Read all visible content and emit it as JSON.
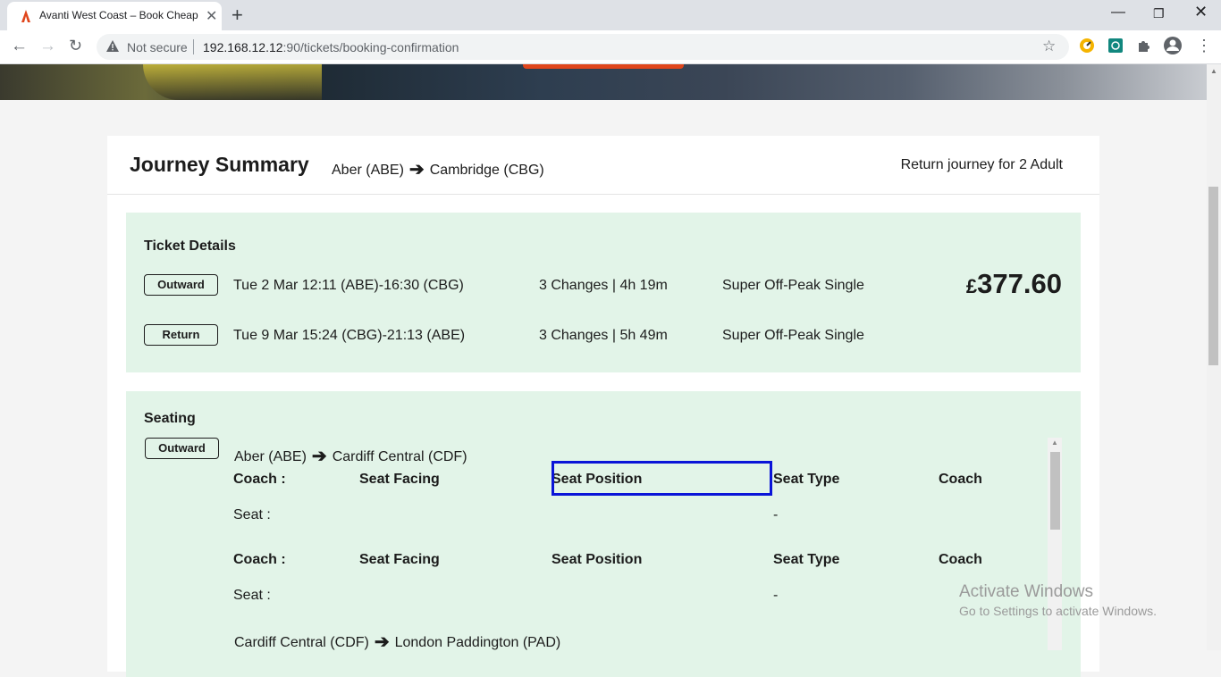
{
  "browser": {
    "tab_title": "Avanti West Coast – Book Cheap",
    "security_label": "Not secure",
    "url_host": "192.168.12.12",
    "url_path": ":90/tickets/booking-confirmation",
    "icons": [
      "avanti-favicon",
      "close-icon",
      "new-tab-icon",
      "minimize-icon",
      "restore-icon",
      "close-window-icon",
      "back-icon",
      "forward-icon",
      "reload-icon",
      "warning-icon",
      "star-icon",
      "extension-icons",
      "profile-icon",
      "menu-icon"
    ]
  },
  "summary": {
    "title": "Journey Summary",
    "from": "Aber (ABE)",
    "to": "Cambridge (CBG)",
    "journey_type": "Return journey for 2 Adult"
  },
  "tickets": {
    "heading": "Ticket Details",
    "price_currency": "£",
    "price_amount": "377.60",
    "rows": [
      {
        "badge": "Outward",
        "times": "Tue 2 Mar 12:11 (ABE)-16:30 (CBG)",
        "changes": "3 Changes | 4h 19m",
        "fare": "Super Off-Peak Single"
      },
      {
        "badge": "Return",
        "times": "Tue 9 Mar 15:24 (CBG)-21:13 (ABE)",
        "changes": "3 Changes | 5h 49m",
        "fare": "Super Off-Peak Single"
      }
    ]
  },
  "seating": {
    "heading": "Seating",
    "badge": "Outward",
    "leg1_from": "Aber (ABE)",
    "leg1_to": "Cardiff Central (CDF)",
    "headers": {
      "coach": "Coach :",
      "facing": "Seat Facing",
      "position": "Seat Position",
      "type": "Seat Type",
      "coach2": "Coach"
    },
    "seat_label": "Seat :",
    "seat_type_value": "-",
    "leg2_from": "Cardiff Central (CDF)",
    "leg2_to": "London Paddington (PAD)"
  },
  "watermark": {
    "line1": "Activate Windows",
    "line2": "Go to Settings to activate Windows."
  },
  "colors": {
    "panel_bg": "#e2f4e8",
    "accent_orange": "#e0461c",
    "focus_blue": "#0a14d8"
  }
}
